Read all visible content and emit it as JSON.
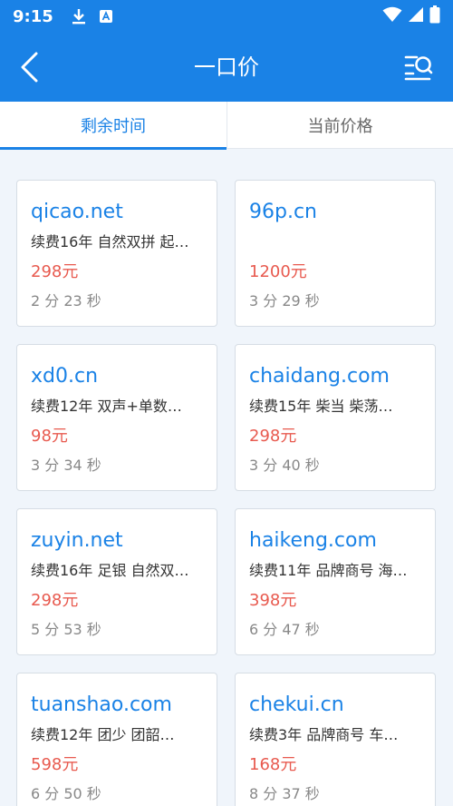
{
  "status_bar": {
    "time": "9:15"
  },
  "navbar": {
    "title": "一口价"
  },
  "tabs": [
    {
      "label": "剩余时间",
      "active": true
    },
    {
      "label": "当前价格",
      "active": false
    }
  ],
  "listings": [
    {
      "domain": "qicao.net",
      "desc": "续费16年 自然双拼 起…",
      "price": "298元",
      "remaining": "2 分 23 秒"
    },
    {
      "domain": "96p.cn",
      "desc": "",
      "price": "1200元",
      "remaining": "3 分 29 秒"
    },
    {
      "domain": "xd0.cn",
      "desc": " 续费12年 双声+单数…",
      "price": "98元",
      "remaining": "3 分 34 秒"
    },
    {
      "domain": "chaidang.com",
      "desc": "续费15年 柴当 柴荡…",
      "price": "298元",
      "remaining": "3 分 40 秒"
    },
    {
      "domain": "zuyin.net",
      "desc": "续费16年 足银 自然双…",
      "price": "298元",
      "remaining": "5 分 53 秒"
    },
    {
      "domain": "haikeng.com",
      "desc": "续费11年 品牌商号 海…",
      "price": "398元",
      "remaining": "6 分 47 秒"
    },
    {
      "domain": "tuanshao.com",
      "desc": "续费12年 团少 团韶…",
      "price": "598元",
      "remaining": "6 分 50 秒"
    },
    {
      "domain": "chekui.cn",
      "desc": "续费3年 品牌商号 车…",
      "price": "168元",
      "remaining": "8 分 37 秒"
    }
  ],
  "colors": {
    "primary": "#1a82e6",
    "price": "#e85a4f",
    "background": "#f0f5fb"
  }
}
